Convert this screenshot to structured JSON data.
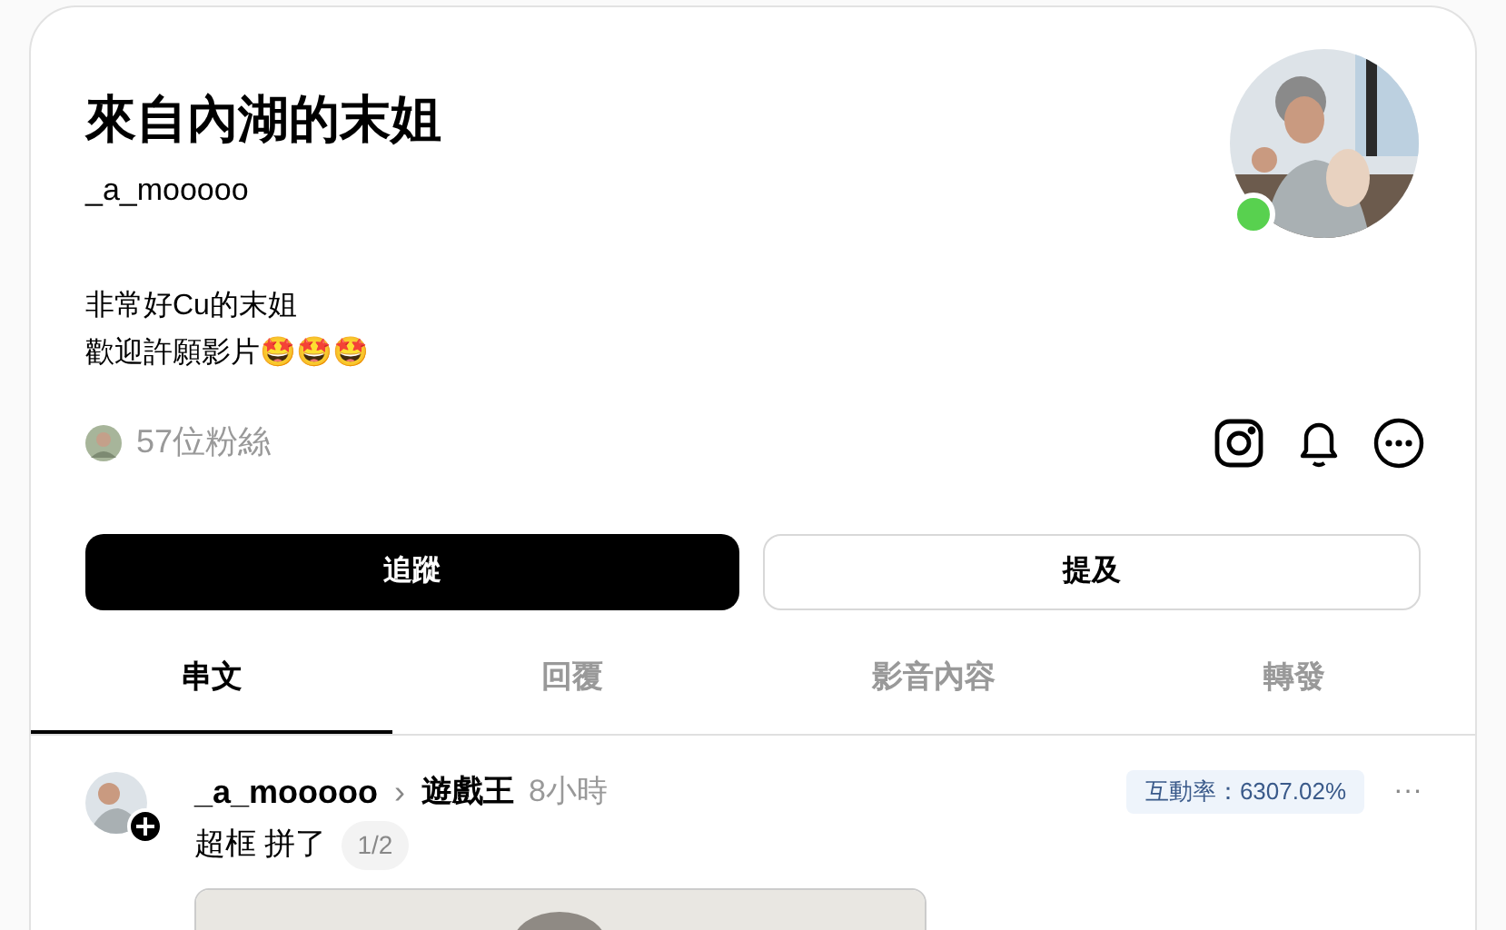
{
  "profile": {
    "name": "來自內湖的末姐",
    "handle": "_a_mooooo",
    "bio": [
      "非常好Cu的末姐",
      "歡迎許願影片🤩🤩🤩"
    ],
    "online": true,
    "followers": "57位粉絲"
  },
  "buttons": [
    {
      "label": "追蹤",
      "kind": "primary"
    },
    {
      "label": "提及",
      "kind": "secondary"
    }
  ],
  "tabs": [
    {
      "label": "串文",
      "selected": true
    },
    {
      "label": "回覆",
      "selected": false
    },
    {
      "label": "影音內容",
      "selected": false
    },
    {
      "label": "轉發",
      "selected": false
    }
  ],
  "post": {
    "author": "_a_mooooo",
    "separator": "›",
    "topic": "遊戲王",
    "time": "8小時",
    "engagement": "互動率：6307.02%",
    "more": "···",
    "text": "超框 拼了",
    "page": "1/2"
  }
}
